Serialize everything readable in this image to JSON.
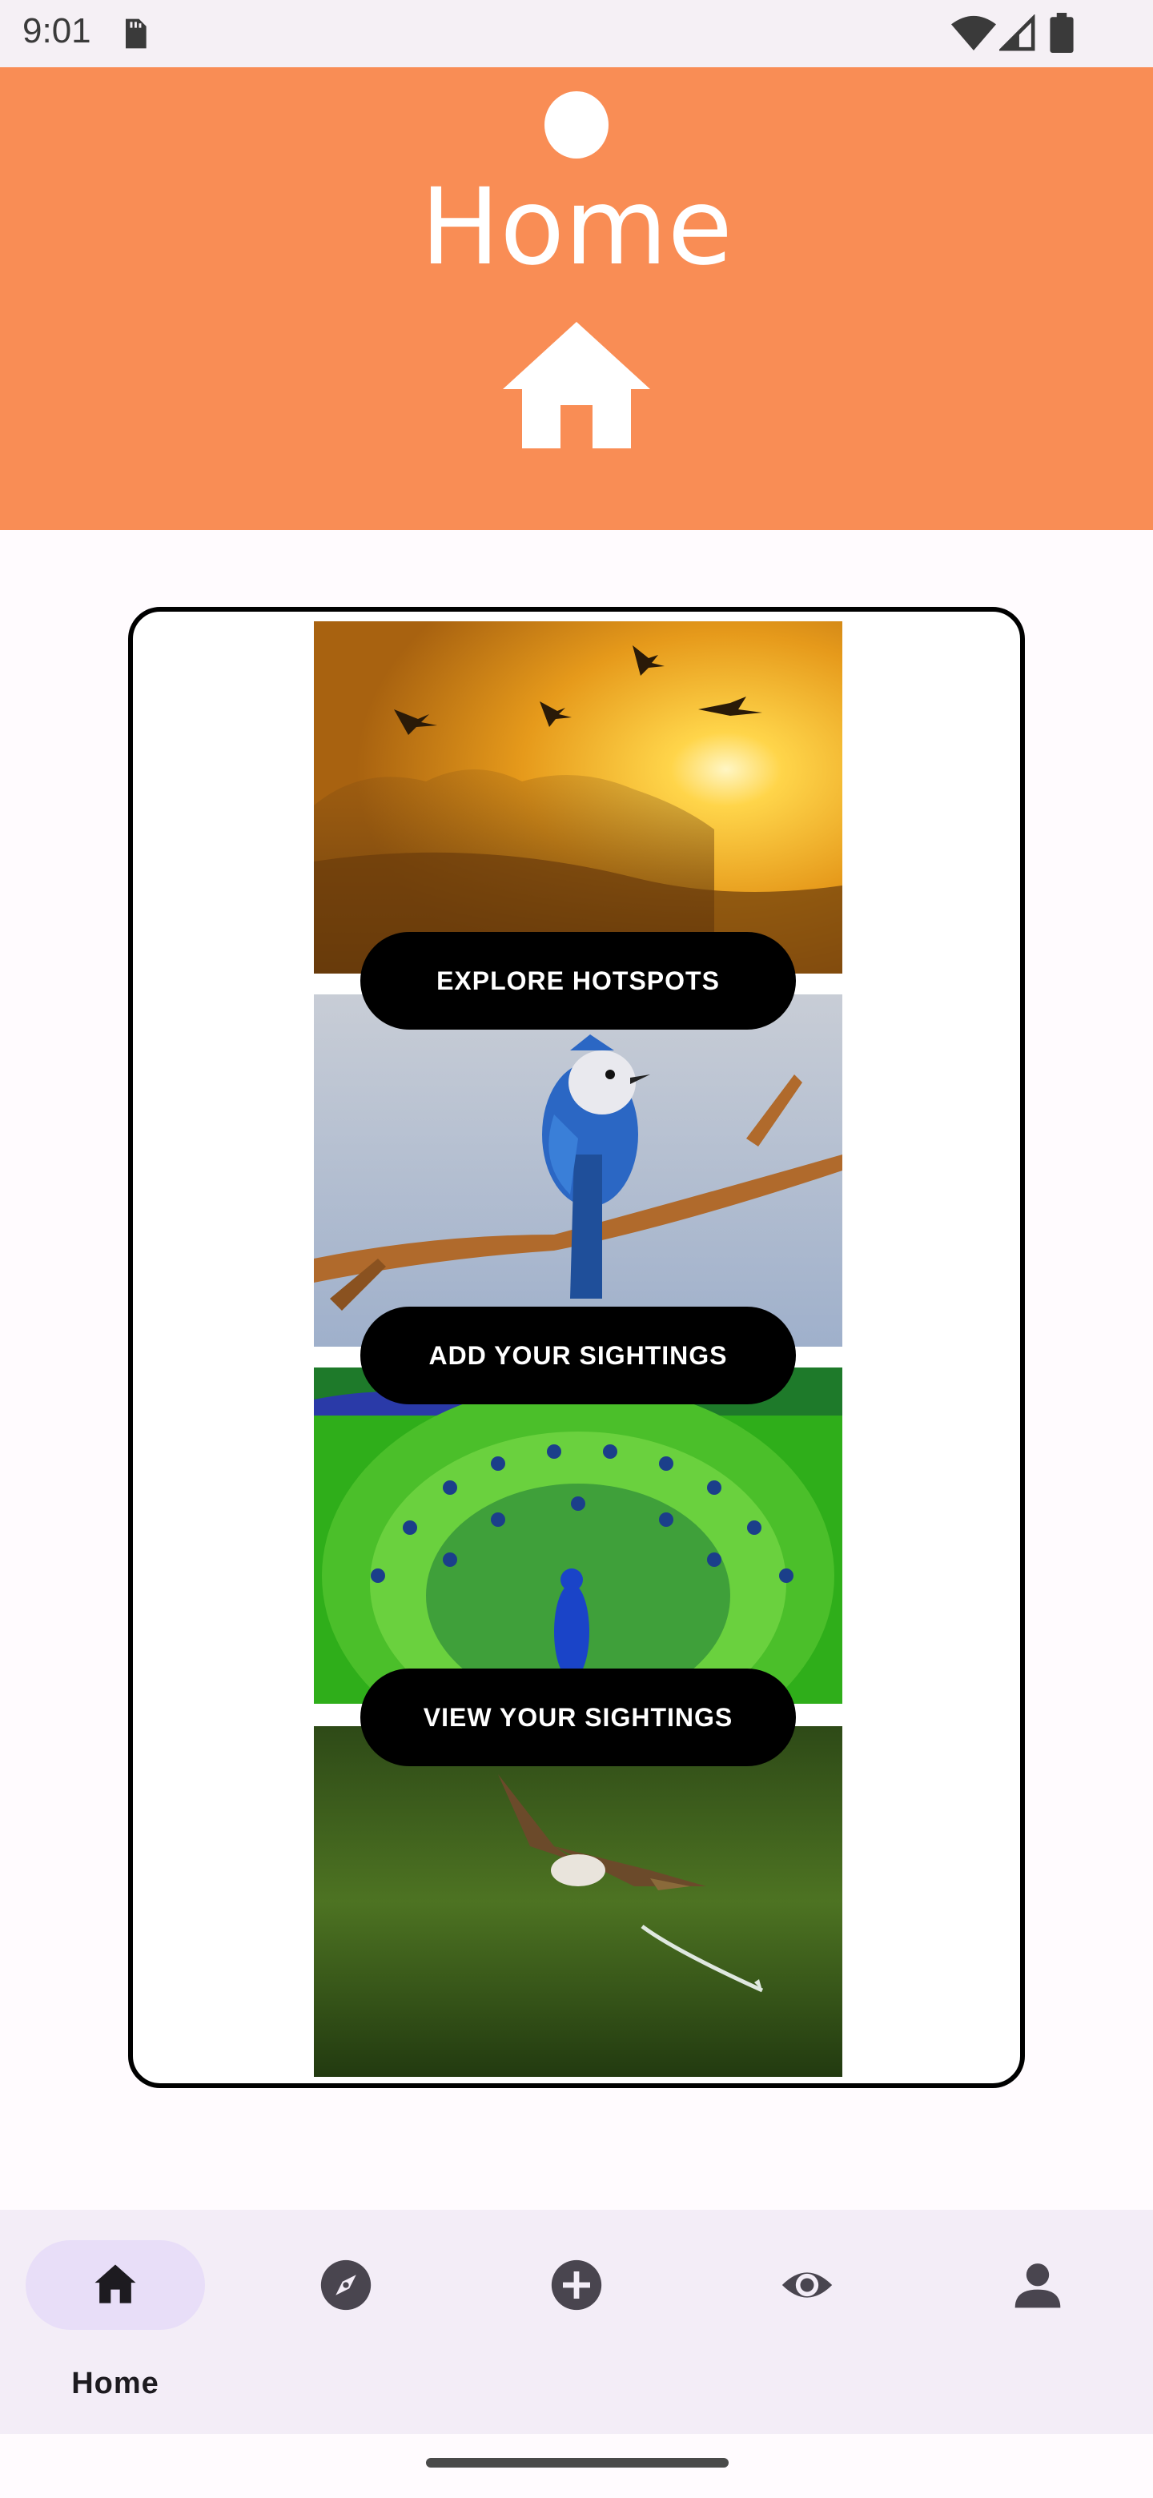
{
  "status_bar": {
    "time": "9:01",
    "icons": [
      "sd-card-icon",
      "wifi-icon",
      "cell-signal-icon",
      "battery-icon"
    ]
  },
  "header": {
    "title": "Home",
    "icon": "home-icon",
    "background": "#f98d55"
  },
  "card": {
    "tiles": [
      {
        "image": "geese-flying-sunset-image"
      },
      {
        "image": "blue-jay-on-branch-image"
      },
      {
        "image": "peacock-fanned-tail-image"
      },
      {
        "image": "eagle-catching-fish-image"
      }
    ],
    "buttons": {
      "explore": "EXPLORE HOTSPOTS",
      "add": "ADD YOUR SIGHTINGS",
      "view": "VIEW YOUR SIGHTINGS"
    }
  },
  "bottom_nav": {
    "items": [
      {
        "icon": "home-icon",
        "label": "Home",
        "selected": true
      },
      {
        "icon": "compass-icon",
        "label": "",
        "selected": false
      },
      {
        "icon": "add-circle-icon",
        "label": "",
        "selected": false
      },
      {
        "icon": "eye-icon",
        "label": "",
        "selected": false
      },
      {
        "icon": "person-icon",
        "label": "",
        "selected": false
      }
    ],
    "background": "#f3edf7",
    "selected_indicator": "#e8def8"
  }
}
